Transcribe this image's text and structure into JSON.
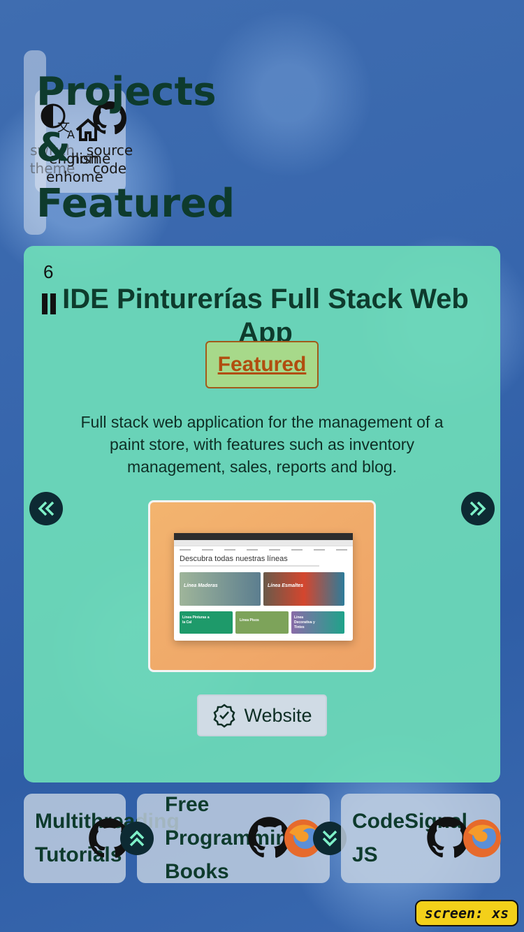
{
  "nav": {
    "switch_theme": "switch\ntheme",
    "english": "english\nenhome",
    "home": "home",
    "source_code": "source\ncode"
  },
  "page_title": "Projects & Featured",
  "featured_card": {
    "counter": "6",
    "title": "IDE Pinturerías Full Stack Web App",
    "badge": "Featured",
    "description": "Full stack web application for the management of a paint store, with features such as inventory management, sales, reports and blog.",
    "website_label": "Website",
    "screenshot": {
      "heading": "Descubra todas nuestras líneas",
      "tiles": [
        "Línea Maderas",
        "Línea Esmaltes",
        "Línea Pinturas a la Cal",
        "Línea Pisos",
        "Línea Decorativa y Tintes"
      ]
    }
  },
  "bottom_cards": [
    {
      "title": "Multithreading Tutorials"
    },
    {
      "title": "Free Programming Books"
    },
    {
      "title": "CodeSignal JS"
    }
  ],
  "screen_tag": "screen: xs",
  "colors": {
    "card_bg": "#6edcb9",
    "title": "#0e3b2d",
    "badge_text": "#b14d0f",
    "badge_bg": "#a7d98a",
    "button_dark": "#0d2a33",
    "tag_bg": "#f3d01a"
  }
}
